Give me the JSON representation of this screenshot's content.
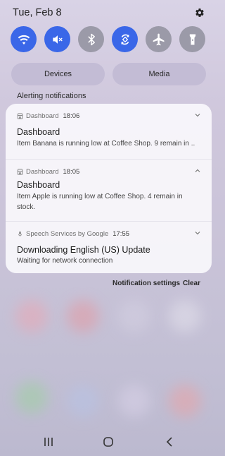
{
  "status": {
    "date": "Tue, Feb 8"
  },
  "quick_settings": [
    {
      "name": "wifi",
      "state": "on"
    },
    {
      "name": "mute",
      "state": "on"
    },
    {
      "name": "bluetooth",
      "state": "off"
    },
    {
      "name": "auto-rotate",
      "state": "on"
    },
    {
      "name": "airplane",
      "state": "off"
    },
    {
      "name": "flashlight",
      "state": "off"
    }
  ],
  "buttons": {
    "devices": "Devices",
    "media": "Media"
  },
  "section": {
    "label": "Alerting notifications"
  },
  "notifications": [
    {
      "app": "Dashboard",
      "time": "18:06",
      "title": "Dashboard",
      "text": "Item Banana is running low at Coffee Shop. 9 remain in ..",
      "expanded": false
    },
    {
      "app": "Dashboard",
      "time": "18:05",
      "title": "Dashboard",
      "text": "Item Apple is running low at Coffee Shop. 4 remain in stock.",
      "expanded": true
    },
    {
      "app": "Speech Services by Google",
      "time": "17:55",
      "title": "Downloading English (US) Update",
      "text": "Waiting for network connection",
      "expanded": false
    }
  ],
  "actions": {
    "settings": "Notification settings",
    "clear": "Clear"
  },
  "colors": {
    "accent": "#3a67e8",
    "tile_off": "#9b9aa8"
  }
}
